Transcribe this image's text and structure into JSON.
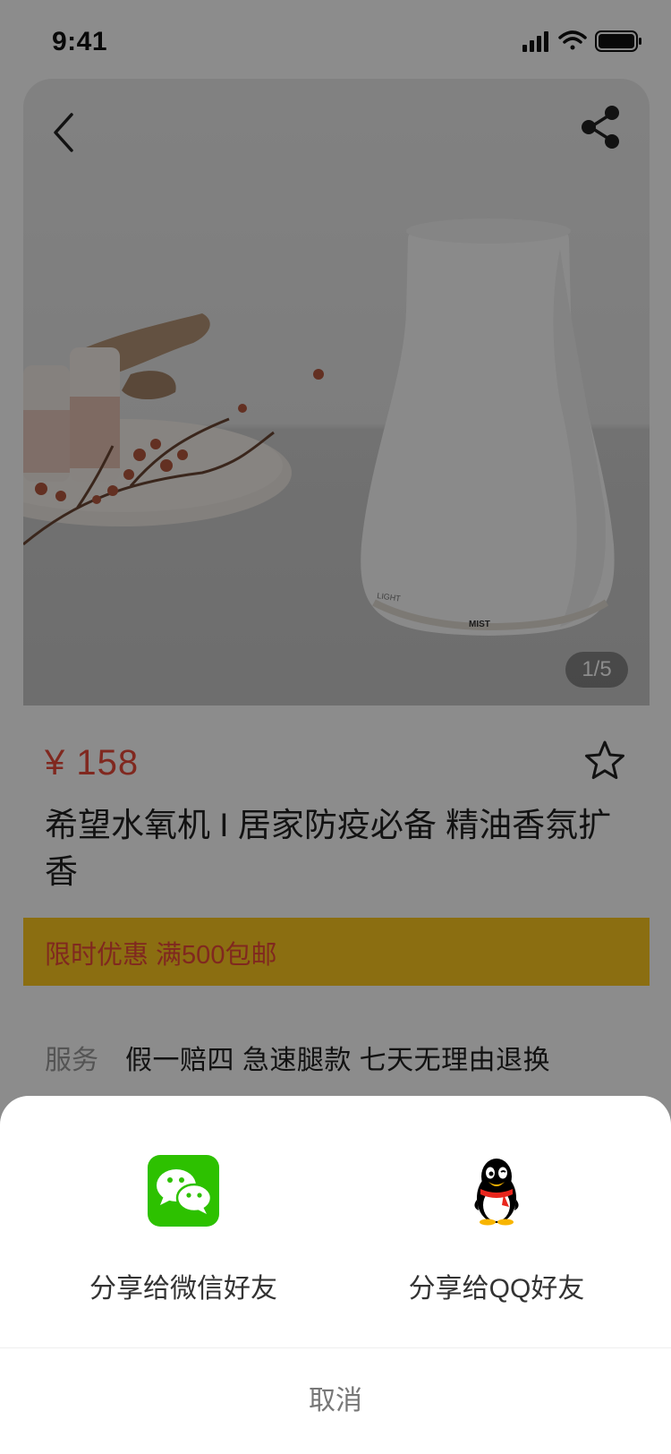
{
  "status_bar": {
    "time": "9:41"
  },
  "product": {
    "image_counter": "1/5",
    "price": "¥ 158",
    "title": "希望水氧机 I 居家防疫必备 精油香氛扩香",
    "promo": "限时优惠 满500包邮",
    "service_label": "服务",
    "service_value": "假一赔四 急速腿款 七天无理由退换",
    "image_text": {
      "light": "LIGHT",
      "mist": "MIST"
    }
  },
  "share_sheet": {
    "options": [
      {
        "label": "分享给微信好友",
        "icon": "wechat-icon",
        "color": "#2dc100"
      },
      {
        "label": "分享给QQ好友",
        "icon": "qq-penguin-icon"
      }
    ],
    "cancel_label": "取消"
  },
  "colors": {
    "price": "#e94a3a",
    "promo_background": "#fdc91f",
    "overlay": "rgba(0,0,0,0.45)"
  }
}
